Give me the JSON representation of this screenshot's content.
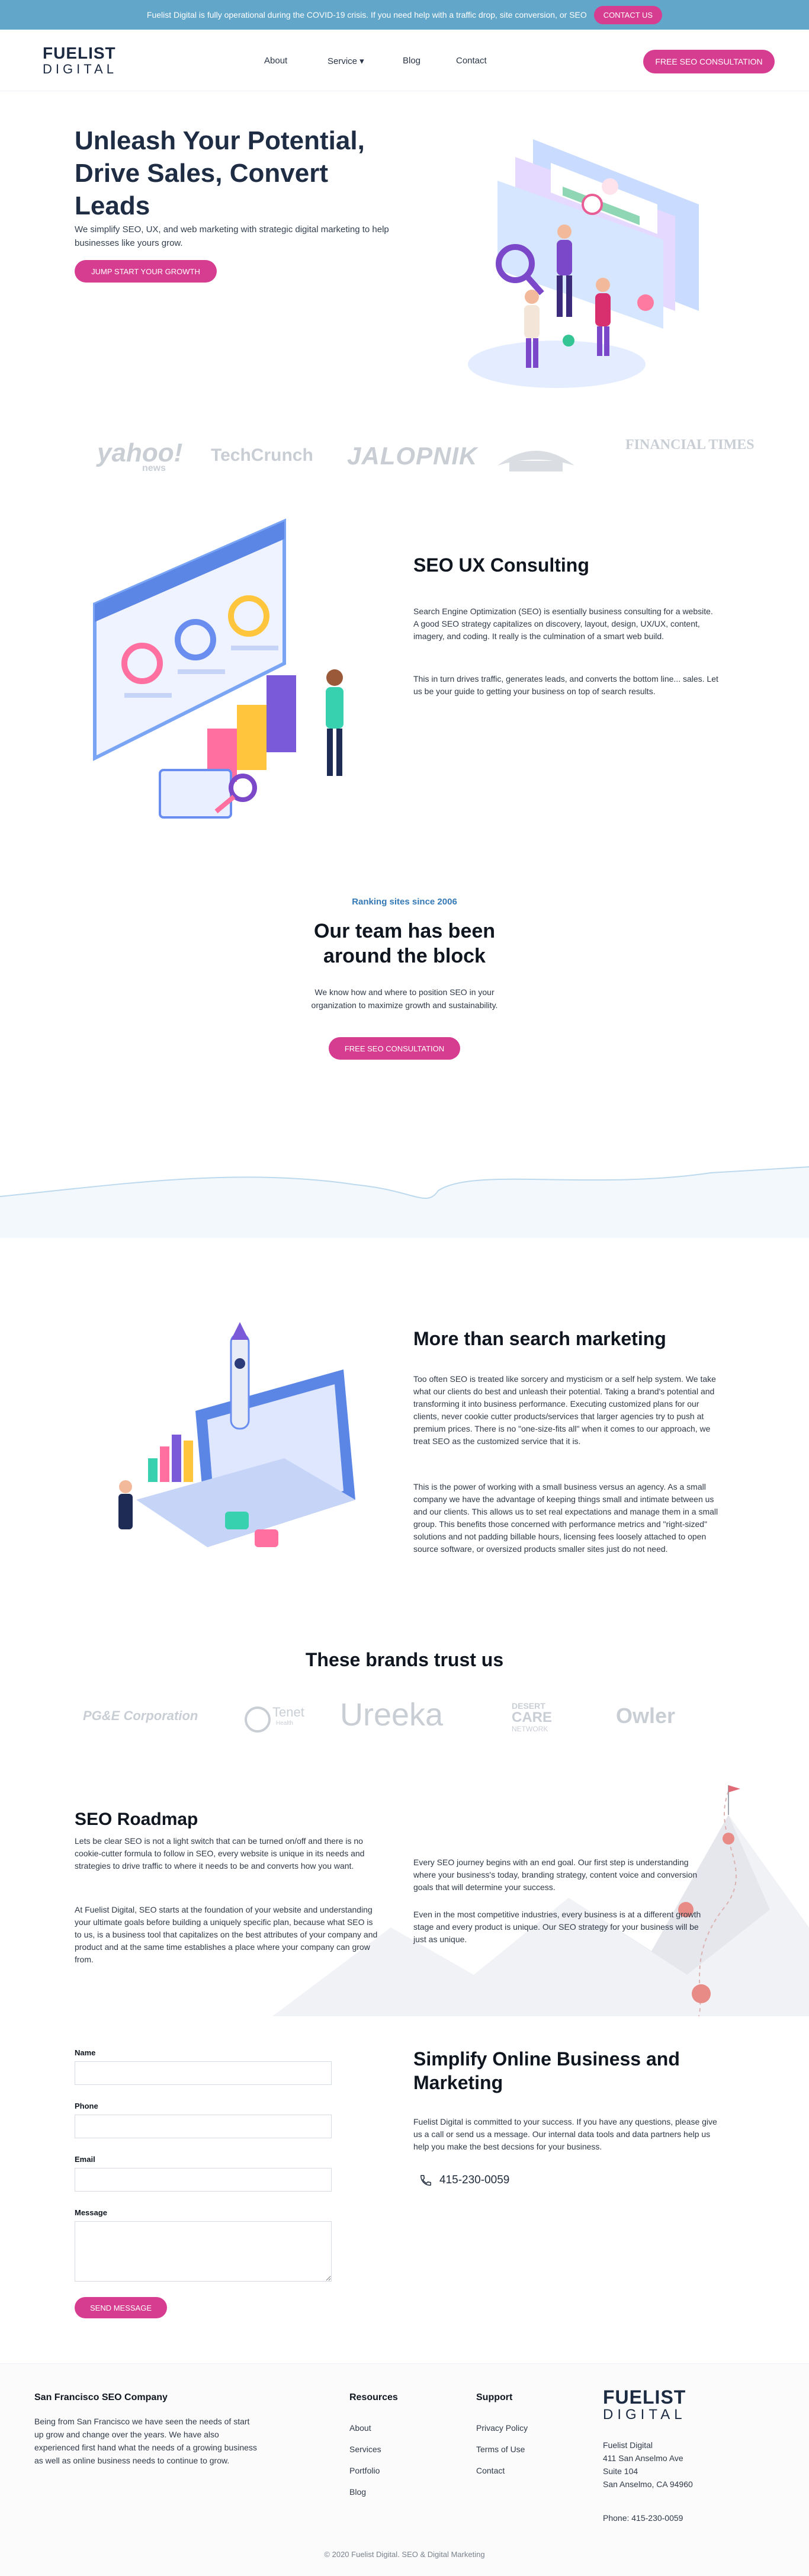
{
  "banner": {
    "text": "Fuelist Digital is fully operational during the COVID-19 crisis. If you need help with a traffic drop, site conversion, or SEO",
    "cta": "CONTACT US"
  },
  "header": {
    "logo_line1": "FUELIST",
    "logo_line2": "DIGITAL",
    "nav": {
      "about": "About",
      "service": "Service ▾",
      "blog": "Blog",
      "contact": "Contact"
    },
    "cta": "FREE SEO CONSULTATION"
  },
  "hero": {
    "title": "Unleash Your Potential, Drive Sales, Convert Leads",
    "text": "We simplify SEO, UX, and web marketing with strategic digital marketing to help businesses like yours grow.",
    "cta": "JUMP START YOUR GROWTH"
  },
  "press": {
    "yahoo": "yahoo!",
    "yahoo_sub": "news",
    "techcrunch": "TechCrunch",
    "jalopnik": "JALOPNIK",
    "seal": "Mercury",
    "ft": "FINANCIAL TIMES"
  },
  "ux": {
    "title": "SEO UX Consulting",
    "p1": "Search Engine Optimization (SEO) is esentially business consulting for a website. A good SEO strategy capitalizes on discovery, layout, design, UX/UX, content, imagery, and coding. It really is the culmination of a smart web build.",
    "p2": "This in turn drives traffic, generates leads, and converts the bottom line... sales. Let us be your guide to getting your business on top of search results."
  },
  "team": {
    "kicker": "Ranking sites since 2006",
    "title": "Our team has been around the block",
    "text": "We know how and where to position SEO in your organization to maximize growth and sustainability.",
    "cta": "FREE SEO CONSULTATION"
  },
  "more": {
    "title": "More than search marketing",
    "p1": "Too often SEO is treated like sorcery and mysticism or a self help system. We take what our clients do best and unleash their potential. Taking a brand's potential and transforming it into business performance. Executing customized plans for our clients, never cookie cutter products/services that larger agencies try to push at premium prices. There is no \"one-size-fits all\" when it comes to our approach, we treat SEO as the customized service that it is.",
    "p2": "This is the power of working with a small business versus an agency. As a small company we have the advantage of keeping things small and intimate between us and our clients. This allows us to set real expectations and manage them in a small group. This benefits those concerned with performance metrics and \"right-sized\" solutions and not padding billable hours, licensing fees loosely attached to open source software, or oversized products smaller sites just do not need."
  },
  "brands": {
    "title": "These brands trust us",
    "pge": "PG&E Corporation",
    "tenet": "Tenet",
    "tenet_sub": "Health",
    "ureeka": "Ureeka",
    "dc1": "DESERT",
    "dc2": "CARE",
    "dc3": "NETWORK",
    "owler": "Owler"
  },
  "roadmap": {
    "title": "SEO Roadmap",
    "p1": "Lets be clear SEO is not a light switch that can be turned on/off and there is no cookie-cutter formula to follow in SEO, every website is unique in its needs and strategies to drive traffic to where it needs to be and converts how you want.",
    "p2": "At Fuelist Digital, SEO starts at the foundation of your website and understanding your ultimate goals before building a uniquely specific plan, because what SEO is to us, is a business tool that capitalizes on the best attributes of your company and product and at the same time establishes a place where your company can grow from.",
    "p3": "Every SEO journey begins with an end goal. Our first step is understanding where your business's today, branding strategy, content voice and conversion goals that will determine your success.",
    "p4": "Even in the most competitive industries, every business is at a different growth stage and every product is unique. Our SEO strategy for your business will be just as unique."
  },
  "form": {
    "name_label": "Name",
    "phone_label": "Phone",
    "email_label": "Email",
    "message_label": "Message",
    "send": "SEND MESSAGE"
  },
  "contact": {
    "title": "Simplify Online Business and Marketing",
    "text": "Fuelist Digital is committed to your success. If you have any questions, please give us a call or send us a message. Our internal data tools and data partners help us help you make the best decsions for your business.",
    "phone": "415-230-0059"
  },
  "footer": {
    "about_heading": "San Francisco SEO Company",
    "about_text": "Being from San Francisco we have seen the needs of start up grow and change over the years. We have also experienced first hand what the needs of a growing business as well as online business needs to continue to grow.",
    "resources_heading": "Resources",
    "resources": [
      "About",
      "Services",
      "Portfolio",
      "Blog"
    ],
    "support_heading": "Support",
    "support": [
      "Privacy Policy",
      "Terms of Use",
      "Contact"
    ],
    "logo_line1": "FUELIST",
    "logo_line2": "DIGITAL",
    "address": [
      "Fuelist Digital",
      "411 San Anselmo Ave",
      "Suite 104",
      "San Anselmo, CA 94960"
    ],
    "phone": "Phone: 415-230-0059",
    "copyright": "© 2020 Fuelist Digital. SEO & Digital Marketing"
  },
  "colors": {
    "banner": "#62a6c9",
    "accent": "#d63c8f",
    "heading": "#10161f",
    "link_blue": "#3478b6"
  }
}
